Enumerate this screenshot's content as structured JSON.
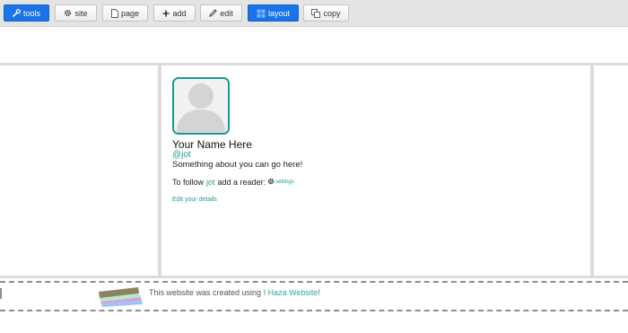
{
  "toolbar": {
    "buttons": [
      {
        "label": "tools",
        "icon": "wrench-icon",
        "active": true
      },
      {
        "label": "site",
        "icon": "gear-icon",
        "active": false
      },
      {
        "label": "page",
        "icon": "page-icon",
        "active": false
      },
      {
        "label": "add",
        "icon": "plus-icon",
        "active": false
      },
      {
        "label": "edit",
        "icon": "pencil-icon",
        "active": false
      },
      {
        "label": "layout",
        "icon": "grid-icon",
        "active": true
      },
      {
        "label": "copy",
        "icon": "copy-icon",
        "active": false
      }
    ]
  },
  "profile": {
    "name": "Your Name Here",
    "handle": "@jot",
    "about": "Something about you can go here!",
    "follow_prefix": "To follow",
    "follow_link": "jot",
    "follow_suffix": "add a reader:",
    "settings_label": "settings",
    "edit_details": "Edit your details"
  },
  "footer": {
    "text": "This website was created using",
    "link": "I Haza Website",
    "end": "!"
  },
  "colors": {
    "accent": "#1a73e8",
    "link": "#1f9b96",
    "toolbar_bg": "#e4e4e4"
  }
}
